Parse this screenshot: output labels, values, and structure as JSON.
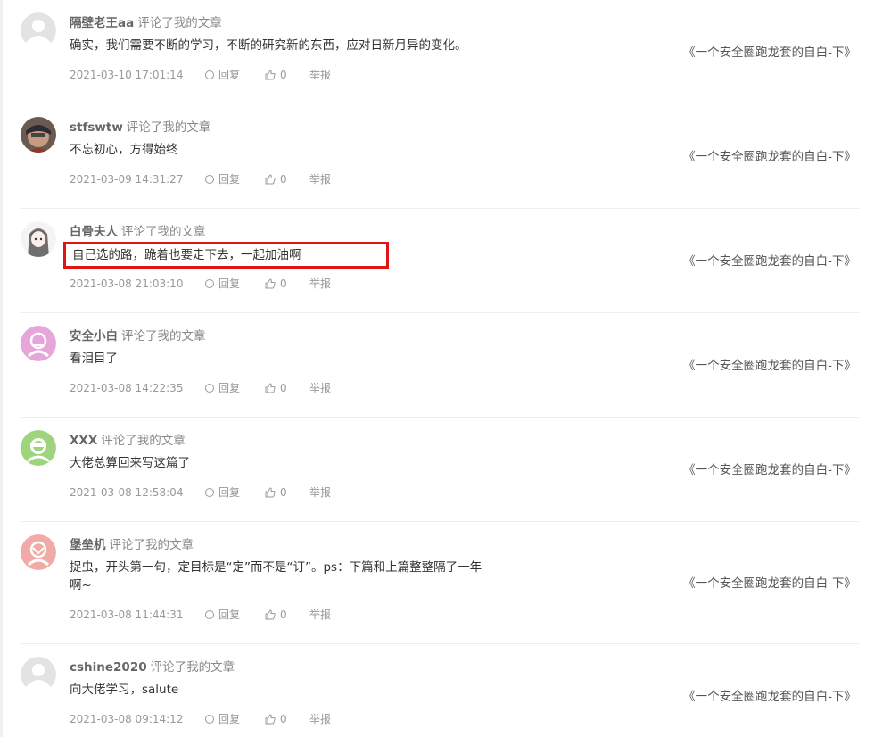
{
  "labels": {
    "action": "评论了我的文章",
    "reply": "回复",
    "report": "举报"
  },
  "comments": [
    {
      "user": "隔壁老王aa",
      "avatar": "default-avatar",
      "content": "确实，我们需要不断的学习，不断的研究新的东西，应对日新月异的变化。",
      "article": "《一个安全圈跑龙套的自白-下》",
      "time": "2021-03-10 17:01:14",
      "likes": "0"
    },
    {
      "user": "stfswtw",
      "avatar": "photo-avatar",
      "content": "不忘初心，方得始终",
      "article": "《一个安全圈跑龙套的自白-下》",
      "time": "2021-03-09 14:31:27",
      "likes": "0"
    },
    {
      "user": "白骨夫人",
      "avatar": "anime-avatar",
      "content": "自己选的路，跪着也要走下去，一起加油啊",
      "article": "《一个安全圈跑龙套的自白-下》",
      "time": "2021-03-08 21:03:10",
      "likes": "0",
      "highlight_color": "#e11414"
    },
    {
      "user": "安全小白",
      "avatar": "pink-avatar",
      "content": "看泪目了",
      "article": "《一个安全圈跑龙套的自白-下》",
      "time": "2021-03-08 14:22:35",
      "likes": "0"
    },
    {
      "user": "XXX",
      "avatar": "green-avatar",
      "content": "大佬总算回来写这篇了",
      "article": "《一个安全圈跑龙套的自白-下》",
      "time": "2021-03-08 12:58:04",
      "likes": "0"
    },
    {
      "user": "堡垒机",
      "avatar": "salmon-avatar",
      "content": "捉虫，开头第一句，定目标是“定”而不是“订”。ps：下篇和上篇整整隔了一年啊~",
      "article": "《一个安全圈跑龙套的自白-下》",
      "time": "2021-03-08 11:44:31",
      "likes": "0"
    },
    {
      "user": "cshine2020",
      "avatar": "default-avatar",
      "content": "向大佬学习，salute",
      "article": "《一个安全圈跑龙套的自白-下》",
      "time": "2021-03-08 09:14:12",
      "likes": "0"
    }
  ],
  "colors": {
    "pink_avatar": "#e7a6d9",
    "green_avatar": "#9ed47c",
    "salmon_avatar": "#f2aaa6",
    "default_avatar": "#e3e3e3",
    "highlight": "#e11414"
  }
}
